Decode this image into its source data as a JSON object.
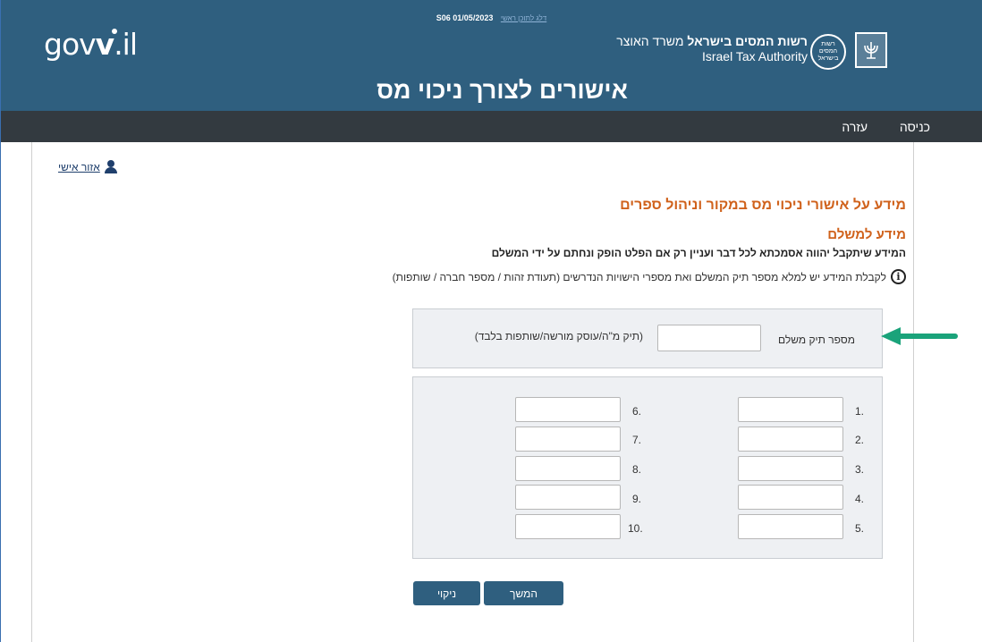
{
  "header": {
    "version_text": "S06 01/05/2023",
    "skip_link": "דלג לתוכן ראשי",
    "logo_text_main": "gov",
    "logo_text_v": "v",
    "logo_text_tail": ".il",
    "authority_he_bold": "רשות המסים בישראל",
    "authority_he_rest": "משרד האוצר",
    "authority_en": "Israel Tax Authority",
    "seal_text": "רשות המסים בישראל",
    "page_title": "אישורים לצורך ניכוי מס"
  },
  "nav": {
    "items": [
      {
        "label": "כניסה"
      },
      {
        "label": "עזרה"
      }
    ]
  },
  "personal_area": {
    "label": "אזור אישי"
  },
  "content": {
    "heading": "מידע על אישורי ניכוי מס במקור וניהול ספרים",
    "subheading": "מידע למשלם",
    "disclaimer": "המידע שיתקבל יהווה אסמכתא לכל דבר ועניין רק אם הפלט הופק ונחתם על ידי המשלם",
    "info_text": "לקבלת המידע יש למלא מספר תיק המשלם ואת מספרי הישויות הנדרשים (תעודת זהות / מספר חברה / שותפות)"
  },
  "payer_form": {
    "label": "מספר תיק משלם",
    "note": "(תיק מ\"ה/עוסק מורשה/שותפות בלבד)",
    "value": ""
  },
  "entities": {
    "right_labels": [
      "1.",
      "2.",
      "3.",
      "4.",
      "5."
    ],
    "left_labels": [
      "6.",
      "7.",
      "8.",
      "9.",
      "10."
    ]
  },
  "buttons": {
    "continue": "המשך",
    "clear": "ניקוי"
  },
  "colors": {
    "header_bg": "#2f5f7f",
    "nav_bg": "#333a40",
    "heading": "#d0621c",
    "arrow": "#1aa37a"
  }
}
